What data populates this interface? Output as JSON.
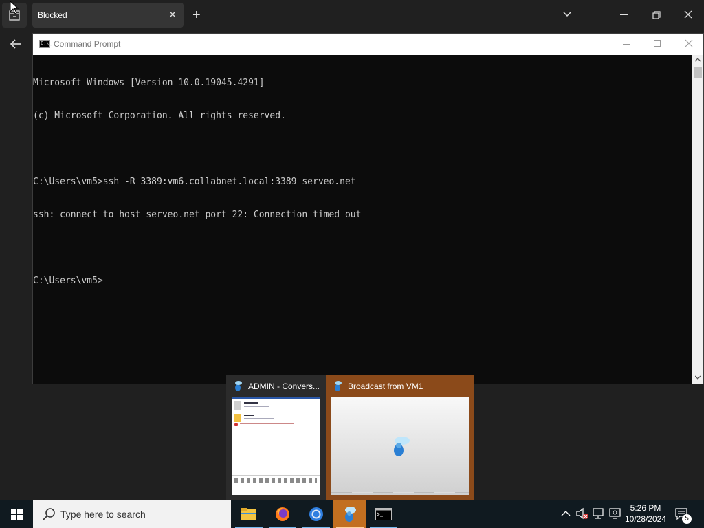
{
  "browser": {
    "tab_title": "Blocked",
    "new_tab_label": "+"
  },
  "cmd_window": {
    "title": "Command Prompt",
    "icon_text": "C:\\_",
    "lines": [
      "Microsoft Windows [Version 10.0.19045.4291]",
      "(c) Microsoft Corporation. All rights reserved.",
      "",
      "C:\\Users\\vm5>ssh -R 3389:vm6.collabnet.local:3389 serveo.net",
      "ssh: connect to host serveo.net port 22: Connection timed out",
      "",
      "C:\\Users\\vm5>"
    ]
  },
  "previews": [
    {
      "title": "ADMIN - Convers..."
    },
    {
      "title": "Broadcast from VM1"
    }
  ],
  "taskbar": {
    "search_placeholder": "Type here to search",
    "apps": [
      {
        "icon": "file-explorer-icon"
      },
      {
        "icon": "firefox-icon"
      },
      {
        "icon": "chrome-icon"
      },
      {
        "icon": "messenger-icon",
        "active": true
      },
      {
        "icon": "command-prompt-icon"
      }
    ],
    "time": "5:26 PM",
    "date": "10/28/2024",
    "notification_count": "5"
  },
  "colors": {
    "accent": "#c26f20",
    "console_bg": "#0c0c0c",
    "console_text": "#cccccc",
    "taskbar_bg": "#101a20"
  }
}
